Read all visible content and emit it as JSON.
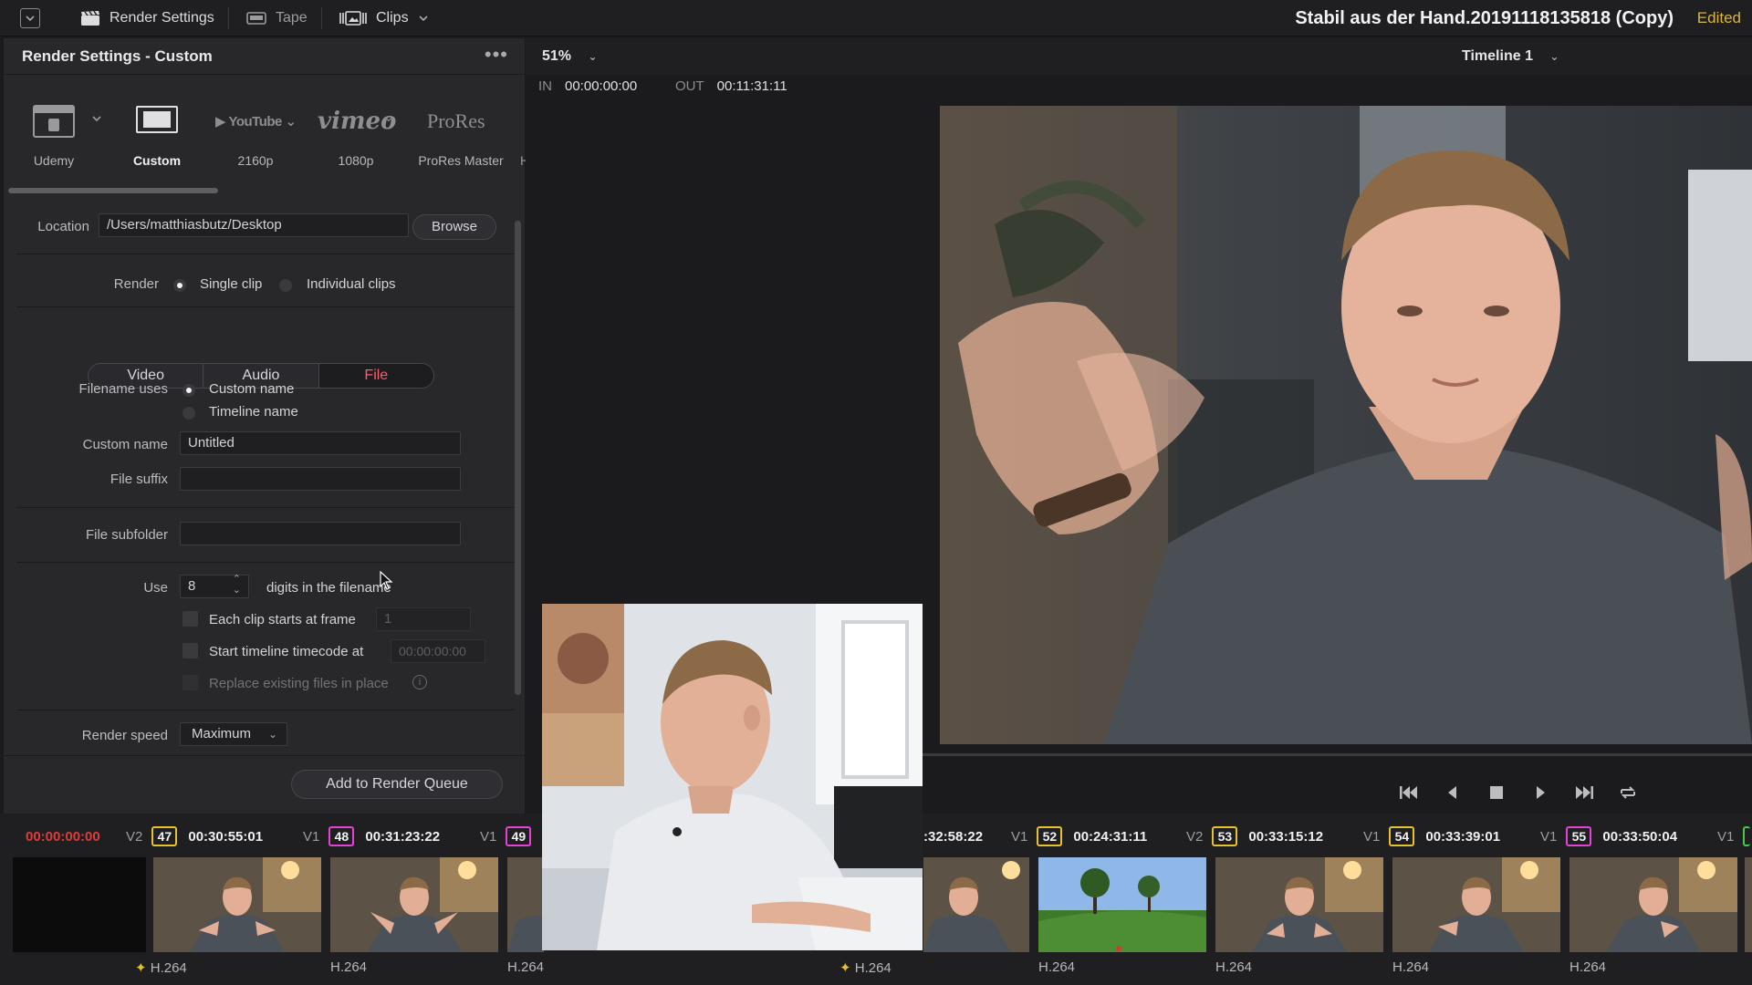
{
  "topbar": {
    "render_settings": "Render Settings",
    "tape": "Tape",
    "clips": "Clips",
    "project_title": "Stabil aus der Hand.20191118135818 (Copy)",
    "edited": "Edited"
  },
  "panel": {
    "title": "Render Settings - Custom",
    "more": "•••"
  },
  "presets": [
    {
      "label": "Udemy"
    },
    {
      "label": "Custom"
    },
    {
      "label": "2160p",
      "logo": "YouTube"
    },
    {
      "label": "1080p",
      "logo": "vimeo"
    },
    {
      "label": "ProRes Master",
      "logo": "ProRes"
    }
  ],
  "form": {
    "location_label": "Location",
    "location_value": "/Users/matthiasbutz/Desktop",
    "browse": "Browse",
    "render_label": "Render",
    "single_clip": "Single clip",
    "individual_clips": "Individual clips",
    "tabs": [
      "Video",
      "Audio",
      "File"
    ],
    "filename_uses_label": "Filename uses",
    "custom_name_option": "Custom name",
    "timeline_name_option": "Timeline name",
    "custom_name_label": "Custom name",
    "custom_name_value": "Untitled",
    "file_suffix_label": "File suffix",
    "file_subfolder_label": "File subfolder",
    "use_label": "Use",
    "digits_value": "8",
    "digits_text": "digits in the filename",
    "each_clip_label": "Each clip starts at frame",
    "each_clip_value": "1",
    "start_tc_label": "Start timeline timecode at",
    "start_tc_value": "00:00:00:00",
    "replace_label": "Replace existing files in place",
    "render_speed_label": "Render speed",
    "render_speed_value": "Maximum",
    "add_queue": "Add to Render Queue"
  },
  "viewer": {
    "zoom": "51%",
    "timeline": "Timeline 1",
    "in_label": "IN",
    "in_value": "00:00:00:00",
    "out_label": "OUT",
    "out_value": "00:11:31:11"
  },
  "clips": {
    "start_tc": "00:00:00:00",
    "items": [
      {
        "track": "V2",
        "num": "47",
        "tc": "00:30:55:01",
        "codec": "H.264"
      },
      {
        "track": "V1",
        "num": "48",
        "tc": "00:31:23:22",
        "codec": "H.264"
      },
      {
        "track": "V1",
        "num": "49",
        "tc": "",
        "codec": "H.264"
      },
      {
        "track": "",
        "num": "",
        "tc": ":32:58:22",
        "codec": "H.264"
      },
      {
        "track": "V1",
        "num": "52",
        "tc": "00:24:31:11",
        "codec": "H.264"
      },
      {
        "track": "V2",
        "num": "53",
        "tc": "00:33:15:12",
        "codec": "H.264"
      },
      {
        "track": "V1",
        "num": "54",
        "tc": "00:33:39:01",
        "codec": "H.264"
      },
      {
        "track": "V1",
        "num": "55",
        "tc": "00:33:50:04",
        "codec": "H.264"
      }
    ],
    "trailing_track": "V1"
  },
  "colors": {
    "accent_red": "#ff5a6a",
    "edited_yellow": "#d8b34a",
    "badge_green": "#6ad04c",
    "badge_yellow": "#e6c22f",
    "badge_pink": "#e542d6"
  }
}
